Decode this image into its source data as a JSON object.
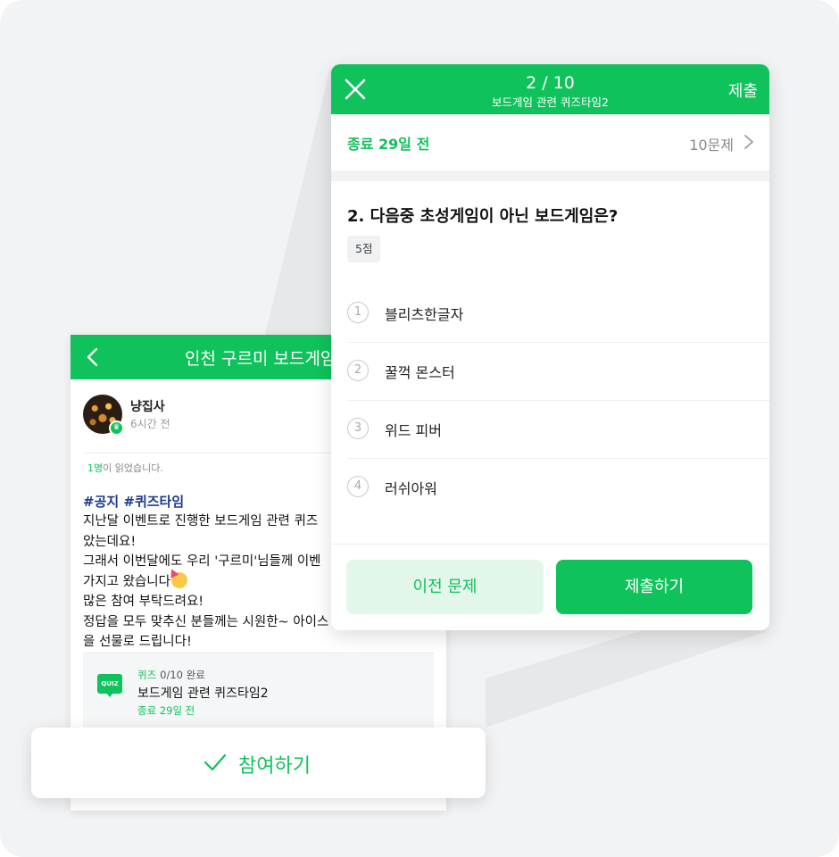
{
  "post": {
    "header_title": "인천 구르미 보드게임",
    "author": "냥집사",
    "time_ago": "6시간 전",
    "read_count": "1명",
    "read_suffix": "이 읽었습니다.",
    "tags": "#공지 #퀴즈타임",
    "body_lines": [
      "지난달 이벤트로 진행한 보드게임 관련 퀴즈",
      "았는데요!",
      "그래서 이번달에도 우리 '구르미'님들께 이벤",
      "가지고 왔습니다",
      "많은 참여 부탁드려요!",
      "정답을 모두 맞추신 분들께는 시원한~ 아이스",
      "을 선물로 드립니다!"
    ],
    "quiz": {
      "icon_text": "QUIZ",
      "keyword": "퀴즈",
      "progress": "0/10 완료",
      "name": "보드게임 관련 퀴즈타임2",
      "ends": "종료 29일 전"
    }
  },
  "join_button_label": "참여하기",
  "quiz_screen": {
    "counter": "2 / 10",
    "subtitle": "보드게임 관련 퀴즈타임2",
    "submit_top": "제출",
    "deadline": "종료 29일 전",
    "total_questions": "10문제",
    "question": "2. 다음중 초성게임이 아닌 보드게임은?",
    "points": "5점",
    "options": [
      {
        "num": "1",
        "text": "블리츠한글자"
      },
      {
        "num": "2",
        "text": "꿀꺽 몬스터"
      },
      {
        "num": "3",
        "text": "위드 피버"
      },
      {
        "num": "4",
        "text": "러쉬아워"
      }
    ],
    "prev_button": "이전 문제",
    "submit_button": "제출하기"
  },
  "colors": {
    "brand_green": "#10c25b",
    "light_green": "#e3f6ea",
    "background": "#f1f3f5"
  }
}
